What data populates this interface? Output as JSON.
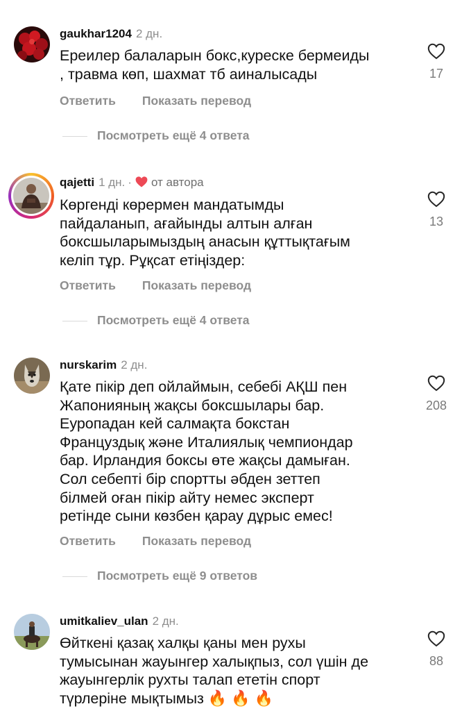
{
  "comments": [
    {
      "username": "gaukhar1204",
      "time": "2 дн.",
      "lines": [
        "Ереилер балаларын бокс,куреске бермеиды",
        ", травма  көп, шахмат тб аиналысады"
      ],
      "likes": "17",
      "reply": "Ответить",
      "translate": "Показать перевод",
      "more_replies": "Посмотреть ещё 4 ответа"
    },
    {
      "username": "qajetti",
      "time": "1 дн.",
      "dot": "·",
      "author_label": "от автора",
      "lines": [
        "Көргенді көрермен мандатымды",
        "пайдаланып, ағайынды алтын алған",
        "боксшыларымыздың анасын құттықтағым",
        "келіп тұр. Рұқсат етіңіздер:"
      ],
      "likes": "13",
      "reply": "Ответить",
      "translate": "Показать перевод",
      "more_replies": "Посмотреть ещё 4 ответа"
    },
    {
      "username": "nurskarim",
      "time": "2 дн.",
      "lines": [
        "Қате пікір деп ойлаймын, себебі АҚШ пен",
        "Жапонияның жақсы боксшылары бар.",
        "Еуропадан кей салмақта бокстан",
        "Француздық және Италиялық чемпиондар",
        "бар. Ирландия боксы өте жақсы дамыған.",
        "Сол себепті бір спортты әбден зеттеп",
        "білмей оған пікір айту немес эксперт",
        "ретінде сыни көзбен қарау дұрыс емес!"
      ],
      "likes": "208",
      "reply": "Ответить",
      "translate": "Показать перевод",
      "more_replies": "Посмотреть ещё 9 ответов"
    },
    {
      "username": "umitkaliev_ulan",
      "time": "2 дн.",
      "lines": [
        "Өйткені қазақ халқы қаны мен рухы",
        "тумысынан жауынгер халықпыз, сол үшін де",
        "жауынгерлік рухты талап ететін спорт",
        "түрлеріне мықтымыз "
      ],
      "emoji": "🔥 🔥 🔥",
      "likes": "88"
    }
  ],
  "colors": {
    "heart_red": "#ed4956",
    "muted": "#8e8e8e"
  },
  "icons": {
    "like": "heart-outline-icon",
    "author_like": "heart-filled-icon"
  }
}
